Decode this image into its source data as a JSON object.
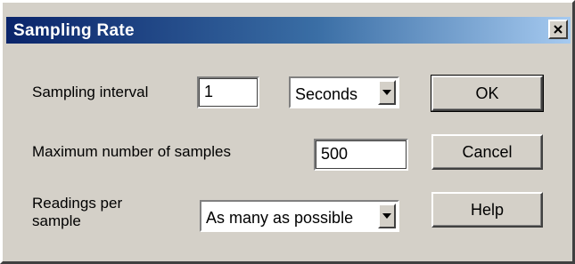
{
  "dialog": {
    "title": "Sampling Rate"
  },
  "sampling_interval": {
    "label": "Sampling interval",
    "value": "1",
    "unit_selected": "Seconds"
  },
  "max_samples": {
    "label": "Maximum number of samples",
    "value": "500"
  },
  "readings_per_sample": {
    "label_line1": "Readings per",
    "label_line2": "sample",
    "selected": "As many as possible"
  },
  "buttons": {
    "ok": "OK",
    "cancel": "Cancel",
    "help": "Help"
  },
  "icons": {
    "close": "close-icon",
    "dropdown": "chevron-down-icon"
  },
  "colors": {
    "face": "#d4d0c8",
    "title_start": "#0a246a",
    "title_end": "#a6caf0",
    "title_text": "#ffffff"
  }
}
